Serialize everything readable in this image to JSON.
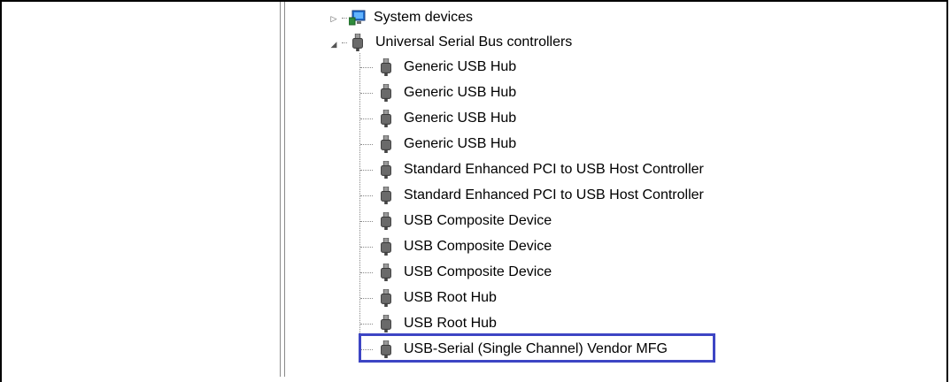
{
  "tree": {
    "system_devices": "System devices",
    "usb_controllers": "Universal Serial Bus controllers",
    "children": [
      "Generic USB Hub",
      "Generic USB Hub",
      "Generic USB Hub",
      "Generic USB Hub",
      "Standard Enhanced PCI to USB Host Controller",
      "Standard Enhanced PCI to USB Host Controller",
      "USB Composite Device",
      "USB Composite Device",
      "USB Composite Device",
      "USB Root Hub",
      "USB Root Hub",
      "USB-Serial (Single Channel) Vendor MFG"
    ],
    "selected_index": 11,
    "icons": {
      "system": "computer-chip-icon",
      "usb": "usb-plug-icon"
    },
    "colors": {
      "selection_border": "#3d45c4"
    }
  }
}
